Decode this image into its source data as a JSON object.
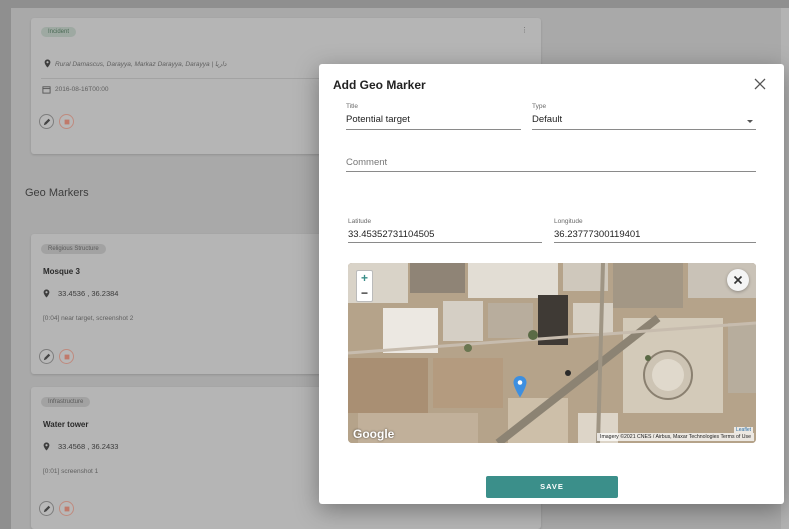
{
  "incident": {
    "tag": "Incident",
    "location": "Rural Damascus, Darayya, Markaz Darayya, Darayya | داريا",
    "date": "2016-08-16T00:00"
  },
  "geo_markers": {
    "section_title": "Geo Markers",
    "items": [
      {
        "tag": "Religious Structure",
        "name": "Mosque 3",
        "coords": "33.4536 , 36.2384",
        "note": "[0:04] near target, screenshot 2"
      },
      {
        "tag": "Infrastructure",
        "name": "Water tower",
        "coords": "33.4568 , 36.2433",
        "note": "[0:01] screenshot 1"
      }
    ]
  },
  "modal": {
    "title": "Add Geo Marker",
    "title_field_label": "Title",
    "title_field_value": "Potential target",
    "type_label": "Type",
    "type_value": "Default",
    "comment_placeholder": "Comment",
    "latitude_label": "Latitude",
    "latitude_value": "33.45352731104505",
    "longitude_label": "Longitude",
    "longitude_value": "36.23777300119401",
    "map": {
      "zoom_in": "+",
      "zoom_out": "−",
      "google": "Google",
      "attribution": "Imagery ©2021 CNES / Airbus, Maxar Technologies   Terms of Use",
      "leaflet": "Leaflet",
      "marker_color": "#3d8fe0"
    },
    "save_label": "SAVE"
  },
  "colors": {
    "accent": "#3b8f8a",
    "overlay": "#a9a9a9"
  }
}
